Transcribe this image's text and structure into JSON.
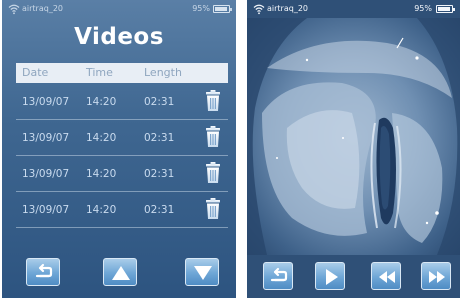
{
  "left_screen": {
    "status": {
      "ssid": "airtraq_20",
      "battery": "95%",
      "battery_level": 0.95
    },
    "title": "Videos",
    "table": {
      "headers": {
        "date": "Date",
        "time": "Time",
        "length": "Length"
      },
      "rows": [
        {
          "date": "13/09/07",
          "time": "14:20",
          "length": "02:31"
        },
        {
          "date": "13/09/07",
          "time": "14:20",
          "length": "02:31"
        },
        {
          "date": "13/09/07",
          "time": "14:20",
          "length": "02:31"
        },
        {
          "date": "13/09/07",
          "time": "14:20",
          "length": "02:31"
        }
      ]
    },
    "toolbar": {
      "icons": [
        "back-icon",
        "up-arrow-icon",
        "down-arrow-icon"
      ]
    }
  },
  "right_screen": {
    "status": {
      "ssid": "airtraq_20",
      "battery": "95%",
      "battery_level": 0.95
    },
    "toolbar": {
      "icons": [
        "back-icon",
        "play-icon",
        "rewind-icon",
        "fast-forward-icon"
      ]
    }
  },
  "colors": {
    "screen_blue": "#3f6791",
    "button_blue": "#6ea6d6",
    "text_light": "#c9dbef"
  }
}
